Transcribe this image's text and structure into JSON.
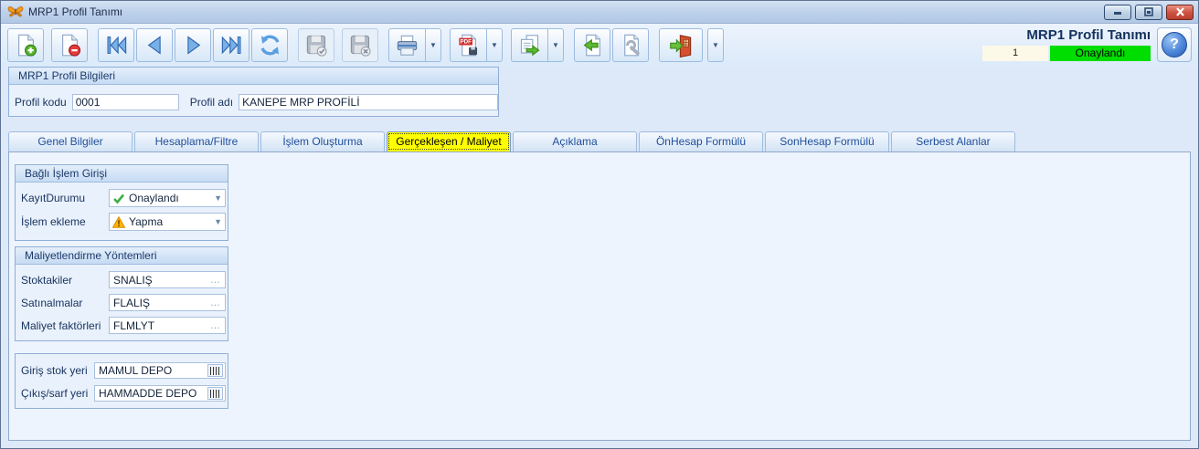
{
  "window": {
    "title": "MRP1 Profil Tanımı"
  },
  "header": {
    "form_title": "MRP1 Profil Tanımı",
    "record_number": "1",
    "status": "Onaylandı",
    "status_color": "#00dd00"
  },
  "toolbar": {
    "icons": [
      "new-record-icon",
      "delete-record-icon",
      "first-record-icon",
      "previous-record-icon",
      "next-record-icon",
      "last-record-icon",
      "refresh-icon",
      "save-icon",
      "save-cancel-icon",
      "print-icon",
      "pdf-export-icon",
      "copy-transfer-icon",
      "import-document-icon",
      "tools-wrench-icon",
      "exit-door-icon",
      "help-icon"
    ]
  },
  "profile_info": {
    "group_title": "MRP1 Profil Bilgileri",
    "profil_kodu_label": "Profil kodu",
    "profil_kodu_value": "0001",
    "profil_adi_label": "Profil adı",
    "profil_adi_value": "KANEPE MRP PROFİLİ"
  },
  "tabs": {
    "items": [
      {
        "label": "Genel Bilgiler"
      },
      {
        "label": "Hesaplama/Filtre"
      },
      {
        "label": "İşlem Oluşturma"
      },
      {
        "label": "Gerçekleşen / Maliyet"
      },
      {
        "label": "Açıklama"
      },
      {
        "label": "ÖnHesap Formülü"
      },
      {
        "label": "SonHesap Formülü"
      },
      {
        "label": "Serbest Alanlar"
      }
    ],
    "active_tab": "Gerçekleşen / Maliyet",
    "active_color": "#ffff00"
  },
  "bagli_islem_girisi": {
    "group_title": "Bağlı İşlem Girişi",
    "kayit_durumu_label": "KayıtDurumu",
    "kayit_durumu_value": "Onaylandı",
    "islem_ekleme_label": "İşlem ekleme",
    "islem_ekleme_value": "Yapma"
  },
  "maliyetlendirme": {
    "group_title": "Maliyetlendirme Yöntemleri",
    "stoktakiler_label": "Stoktakiler",
    "stoktakiler_value": "SNALIŞ",
    "satinalmalar_label": "Satınalmalar",
    "satinalmalar_value": "FLALIŞ",
    "maliyet_faktorleri_label": "Maliyet faktörleri",
    "maliyet_faktorleri_value": "FLMLYT"
  },
  "stok_yerleri": {
    "giris_label": "Giriş stok yeri",
    "giris_value": "MAMUL DEPO",
    "cikis_label": "Çıkış/sarf yeri",
    "cikis_value": "HAMMADDE DEPO"
  }
}
